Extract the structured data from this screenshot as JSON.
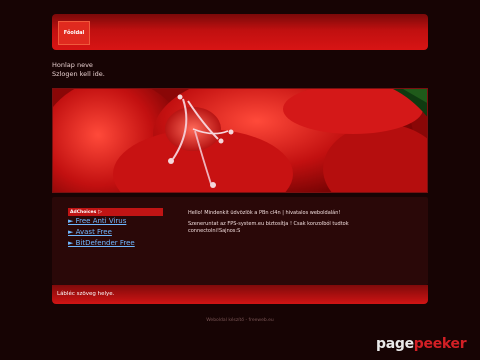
{
  "nav": {
    "items": [
      {
        "label": "Főoldal"
      }
    ]
  },
  "header": {
    "site_name": "Honlap neve",
    "slogan": "Szlogen kell ide."
  },
  "hero": {
    "image": "red-flower-image"
  },
  "sidebar": {
    "adchoices_label": "AdChoices",
    "adchoices_icon": "adchoices-icon",
    "links": [
      {
        "label": "► Free Anti Virus"
      },
      {
        "label": "► Avast Free"
      },
      {
        "label": "► BitDefender Free"
      }
    ],
    "link_color": "#6fb7ff"
  },
  "main": {
    "paragraphs": [
      "Hello! Mindenkit üdvözlök a PBn cl4n | hivatalos weboldalán!",
      "Szeneruntat az FPS-system.eu biztosítja ! Csak konzolból tudtok connectolni!Sajnos:S"
    ]
  },
  "footer": {
    "text": "Lábléc szöveg helye."
  },
  "credit": {
    "text": "Weboldal készítő - freeweb.eu"
  },
  "watermark": {
    "part1": "page",
    "part2": "peeker"
  },
  "colors": {
    "background": "#170404",
    "accent": "#d81414",
    "content_bg": "#2a0808"
  }
}
